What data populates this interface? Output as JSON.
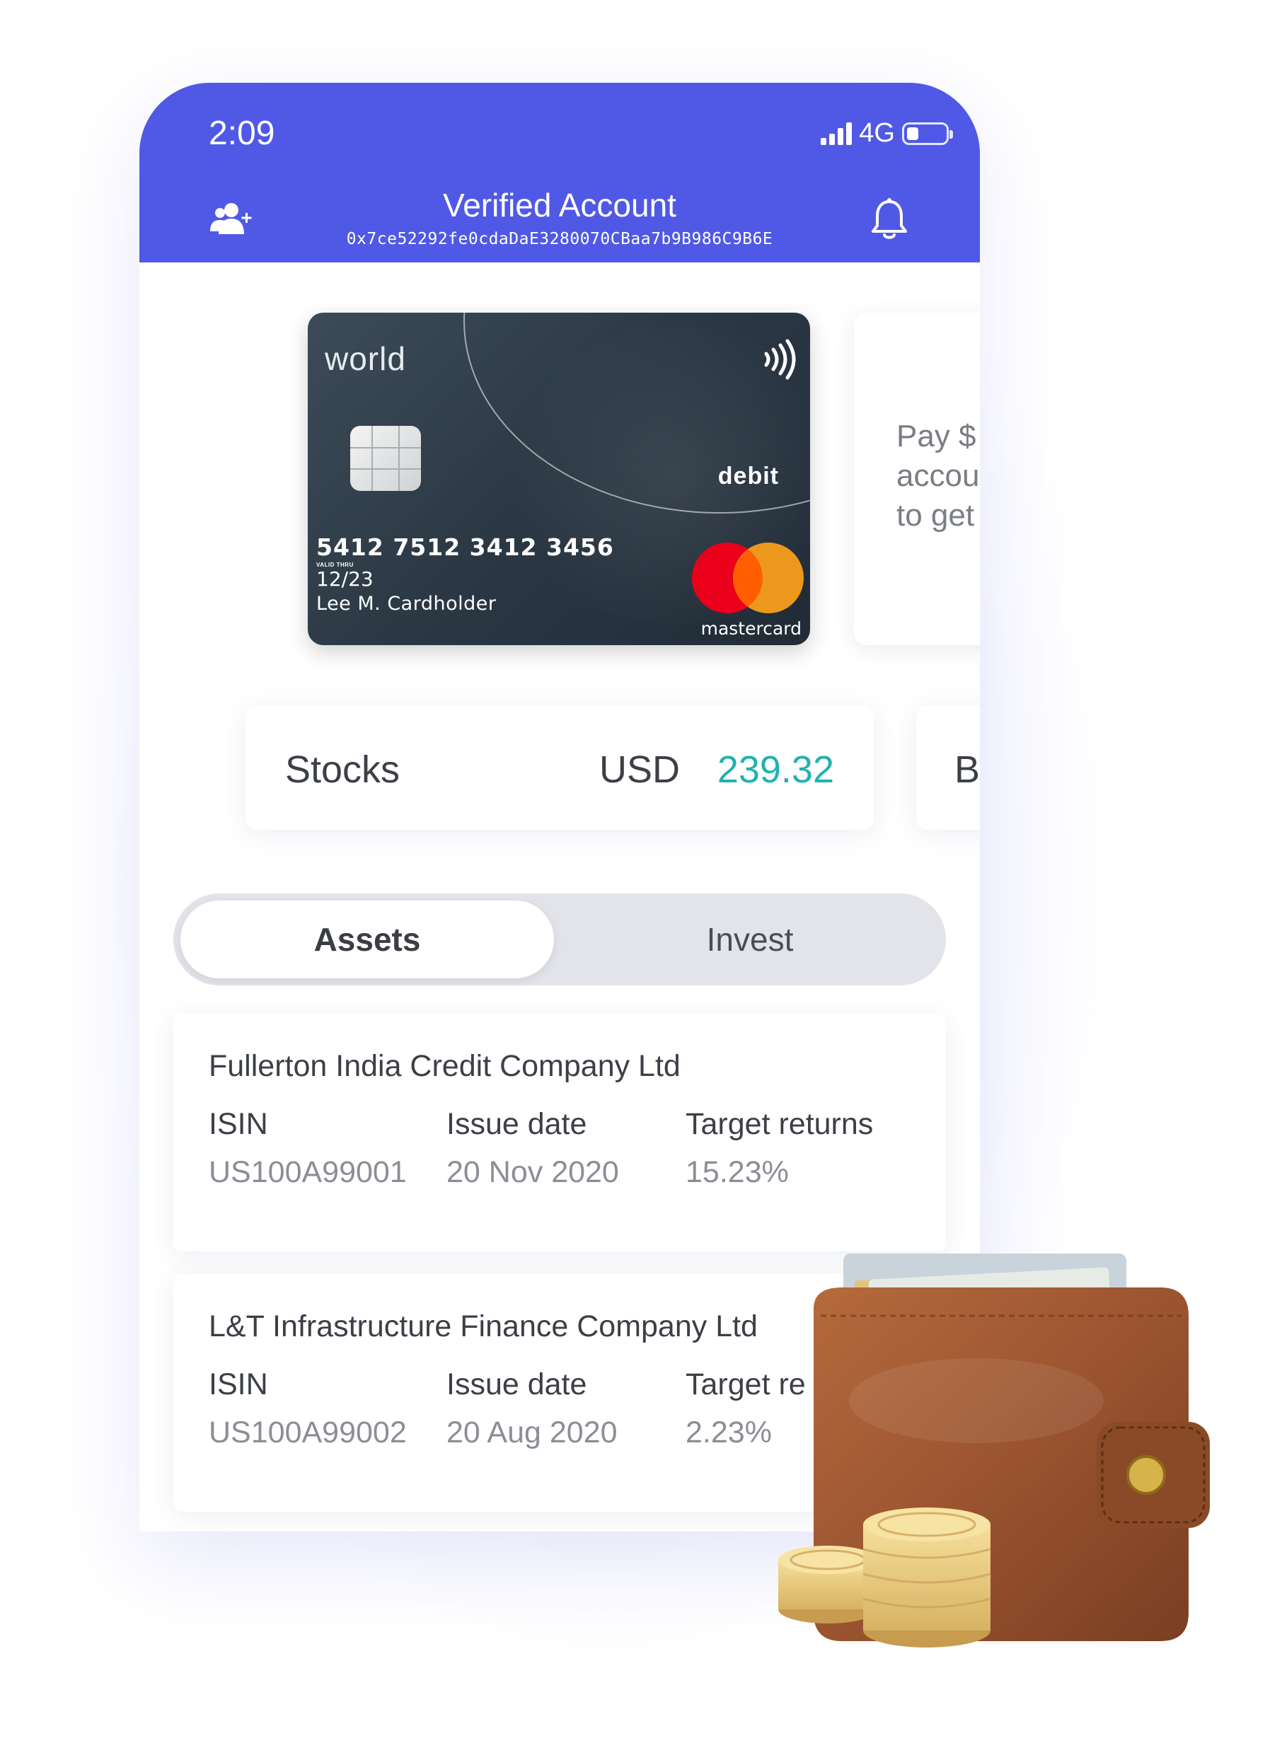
{
  "status_bar": {
    "time": "2:09",
    "network": "4G",
    "signal_bars": 4,
    "battery_level": 0.3
  },
  "header": {
    "title": "Verified Account",
    "address": "0x7ce52292fe0cdaDaE3280070CBaa7b9B986C9B6E",
    "left_icon": "add-user-icon",
    "right_icon": "bell-icon",
    "background_color": "#5059e6"
  },
  "card": {
    "brand": "world",
    "type": "debit",
    "number": "5412 7512 3412 3456",
    "valid_thru_label": "VALID THRU",
    "expiry": "12/23",
    "holder": "Lee M. Cardholder",
    "network": "mastercard"
  },
  "promo": {
    "text": "Pay $\naccou\nto get"
  },
  "balance": {
    "label": "Stocks",
    "currency": "USD",
    "amount": "239.32",
    "amount_color": "#1fb2b1",
    "next_label": "B"
  },
  "tabs": [
    {
      "label": "Assets",
      "active": true
    },
    {
      "label": "Invest",
      "active": false
    }
  ],
  "assets": [
    {
      "name": "Fullerton India Credit Company Ltd",
      "isin_label": "ISIN",
      "isin": "US100A99001",
      "issue_label": "Issue date",
      "issue_date": "20 Nov 2020",
      "returns_label": "Target returns",
      "returns": "15.23%"
    },
    {
      "name": "L&T Infrastructure Finance Company Ltd",
      "isin_label": "ISIN",
      "isin": "US100A99002",
      "issue_label": "Issue date",
      "issue_date": "20 Aug 2020",
      "returns_label": "Target re",
      "returns": "2.23%"
    }
  ],
  "decoration": {
    "wallet": "wallet-with-coins-illustration"
  }
}
